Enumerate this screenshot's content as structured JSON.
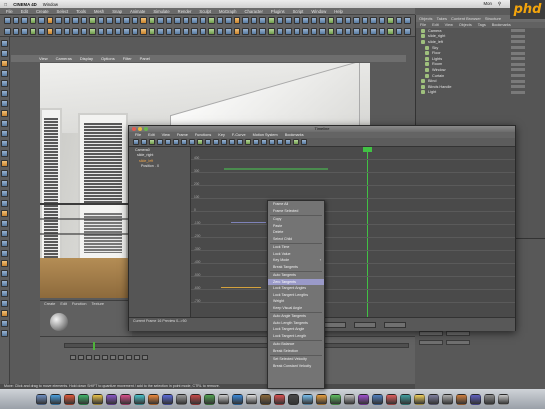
{
  "macbar": {
    "apple": "",
    "app": "CINEMA 4D",
    "window": "Window",
    "right_items": [
      "",
      "Mon",
      "Q"
    ]
  },
  "c4d": {
    "title": "CINEMA 4D",
    "menus": [
      "File",
      "Edit",
      "Create",
      "Select",
      "Tools",
      "Mesh",
      "Snap",
      "Animate",
      "Simulate",
      "Render",
      "Sculpt",
      "MoGraph",
      "Character",
      "Plugins",
      "Script",
      "Window",
      "Help"
    ]
  },
  "viewport_menu": [
    "View",
    "Cameras",
    "Display",
    "Options",
    "Filter",
    "Panel"
  ],
  "objects": {
    "tabs": [
      "Objects",
      "Takes",
      "Content Browser",
      "Structure"
    ],
    "menus": [
      "File",
      "Edit",
      "View",
      "Objects",
      "Tags",
      "Bookmarks"
    ],
    "rows": [
      "Camera",
      "slide_right",
      "slide_left",
      "Sky",
      "Floor",
      "Lights",
      "Room",
      "Window",
      "Curtain",
      "Blind",
      "Blinds Handle",
      "Light"
    ]
  },
  "logo": "phd",
  "material": {
    "menus": [
      "Create",
      "Edit",
      "Function",
      "Texture"
    ]
  },
  "statusbar": "Move: Click and drag to move elements. Hold down SHIFT to quantize movement / add to the selection in point mode, CTRL to remove.",
  "timeline": {
    "title": "Timeline",
    "menus": [
      "File",
      "Edit",
      "View",
      "Frame",
      "Functions",
      "Key",
      "F-Curve",
      "Motion System",
      "Bookmarks"
    ],
    "tracks": [
      {
        "label": "Camera0",
        "orange": false
      },
      {
        "label": "slide_right",
        "orange": false
      },
      {
        "label": "slide_left",
        "orange": true
      },
      {
        "label": "Position . X",
        "orange": false
      }
    ],
    "status": "Current Frame  16  Preview  0-->50",
    "buttons": [
      "",
      "",
      ""
    ],
    "value_labels": [
      "400",
      "300",
      "200",
      "100",
      "0",
      "-100",
      "-200",
      "-300",
      "-400",
      "-500",
      "-600",
      "-700"
    ]
  },
  "context_menu": {
    "items": [
      {
        "label": "Frame All",
        "sub": false
      },
      {
        "label": "Frame Selected",
        "sub": false
      },
      {
        "sep": true
      },
      {
        "label": "Copy",
        "sub": false
      },
      {
        "label": "Paste",
        "sub": false
      },
      {
        "label": "Delete",
        "sub": false
      },
      {
        "label": "Select Child",
        "sub": false
      },
      {
        "sep": true
      },
      {
        "label": "Lock Time",
        "sub": false
      },
      {
        "label": "Lock Value",
        "sub": false
      },
      {
        "label": "Key Mode",
        "sub": true
      },
      {
        "label": "Break Tangents",
        "sub": false
      },
      {
        "sep": true
      },
      {
        "label": "Auto Tangents",
        "sub": false
      },
      {
        "label": "Zero Tangents",
        "sub": false,
        "highlight": true
      },
      {
        "label": "Lock Tangent Angles",
        "sub": false
      },
      {
        "label": "Lock Tangent Lengths",
        "sub": false
      },
      {
        "label": "Weight",
        "sub": false
      },
      {
        "label": "Keep Visual Angle",
        "sub": false
      },
      {
        "sep": true
      },
      {
        "label": "Auto Angle Tangents",
        "sub": false
      },
      {
        "label": "Auto Length Tangents",
        "sub": false
      },
      {
        "label": "Lock Tangent Angle",
        "sub": false
      },
      {
        "label": "Lock Tangent Length",
        "sub": false
      },
      {
        "sep": true
      },
      {
        "label": "Auto Balance",
        "sub": false
      },
      {
        "label": "Break Selection",
        "sub": false
      },
      {
        "sep": true
      },
      {
        "label": "Set Selected Velocity",
        "sub": false
      },
      {
        "label": "Break Constant Velocity",
        "sub": false
      }
    ]
  },
  "colors": {
    "accent_green": "#41c144",
    "track_orange": "#f0a64b",
    "menu_highlight": "#9a9ac9",
    "logo_orange": "#f2a40c"
  }
}
